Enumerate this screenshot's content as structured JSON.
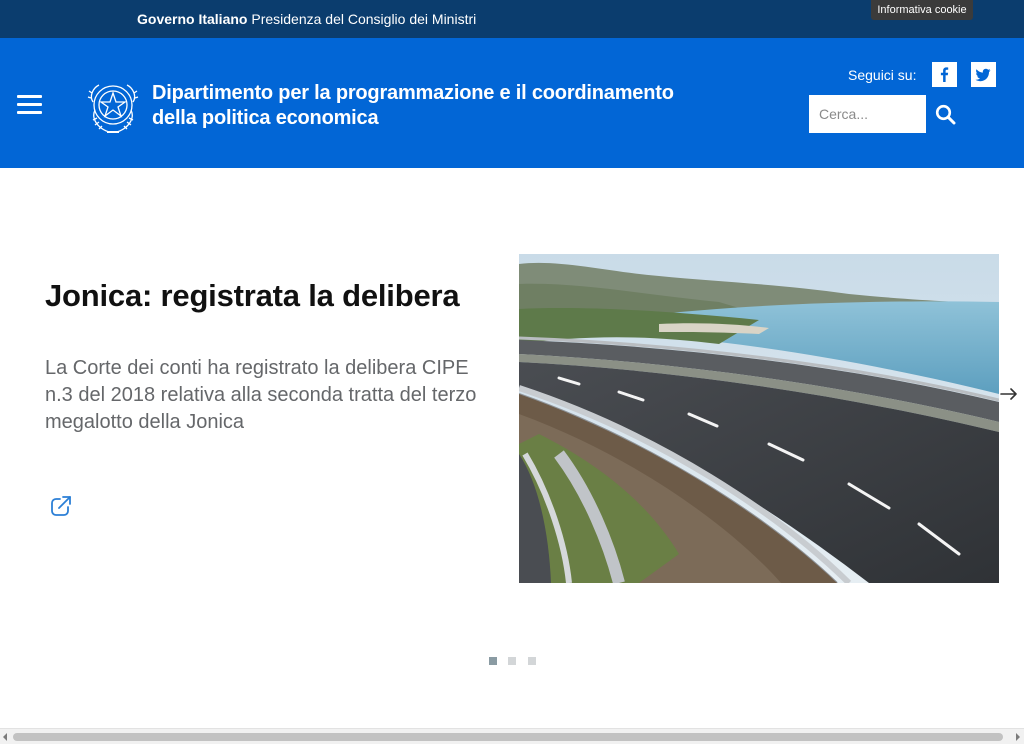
{
  "gov_bar": {
    "brand": "Governo Italiano",
    "text": "Presidenza del Consiglio dei Ministri",
    "cookie_label": "Informativa cookie"
  },
  "header": {
    "title": "Dipartimento per la programmazione e il coordinamento della politica economica",
    "follow_label": "Seguici su:",
    "social": [
      "facebook-icon",
      "twitter-icon"
    ],
    "search_placeholder": "Cerca...",
    "menu_icon": "hamburger-menu-icon",
    "search_icon": "search-icon",
    "emblem_icon": "italian-republic-emblem-icon",
    "colors": {
      "top_bar": "#0b3d6e",
      "header": "#0266d6"
    }
  },
  "slide": {
    "title": "Jonica: registrata la delibera",
    "text": "La Corte dei conti ha registrato la delibera CIPE n.3 del 2018 relativa alla seconda tratta del terzo megalotto della Jonica",
    "link_icon": "external-link-icon",
    "next_icon": "arrow-right-icon"
  },
  "carousel": {
    "count": 3,
    "active": 1
  }
}
